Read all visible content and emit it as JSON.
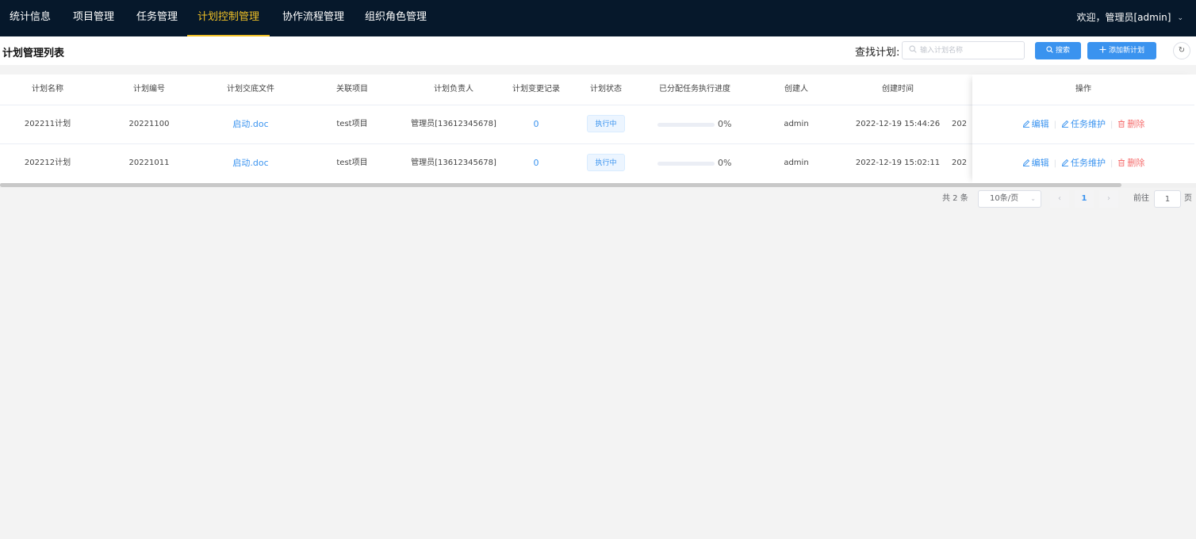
{
  "nav": {
    "items": [
      "统计信息",
      "项目管理",
      "任务管理",
      "计划控制管理",
      "协作流程管理",
      "组织角色管理"
    ],
    "active_index": 3,
    "user": "欢迎，管理员[admin]"
  },
  "toolbar": {
    "title": "计划管理列表",
    "search_label": "查找计划:",
    "search_placeholder": "输入计划名称",
    "search_value": "",
    "search_button": "搜索",
    "add_button": "添加新计划"
  },
  "table": {
    "headers": [
      "计划名称",
      "计划编号",
      "计划交底文件",
      "关联项目",
      "计划负责人",
      "计划变更记录",
      "计划状态",
      "已分配任务执行进度",
      "创建人",
      "创建时间",
      "操作"
    ],
    "rows": [
      {
        "name": "202211计划",
        "code": "20221100",
        "file": "启动.doc",
        "project": "test项目",
        "owner": "管理员[13612345678]",
        "changes": "0",
        "status": "执行中",
        "progress": 0,
        "progress_text": "0%",
        "creator": "admin",
        "created_at": "2022-12-19 15:44:26",
        "overflow": "202"
      },
      {
        "name": "202212计划",
        "code": "20221011",
        "file": "启动.doc",
        "project": "test项目",
        "owner": "管理员[13612345678]",
        "changes": "0",
        "status": "执行中",
        "progress": 0,
        "progress_text": "0%",
        "creator": "admin",
        "created_at": "2022-12-19 15:02:11",
        "overflow": "202"
      }
    ],
    "actions": {
      "edit": "编辑",
      "maintain": "任务维护",
      "delete": "删除"
    }
  },
  "pagination": {
    "total": "共 2 条",
    "page_size": "10条/页",
    "current_page": "1",
    "goto_label": "前往",
    "goto_value": "1",
    "goto_suffix": "页"
  },
  "colors": {
    "nav_bg": "#06182b",
    "nav_active": "#f0c026",
    "primary": "#3a93ef",
    "danger": "#f56c6c"
  }
}
